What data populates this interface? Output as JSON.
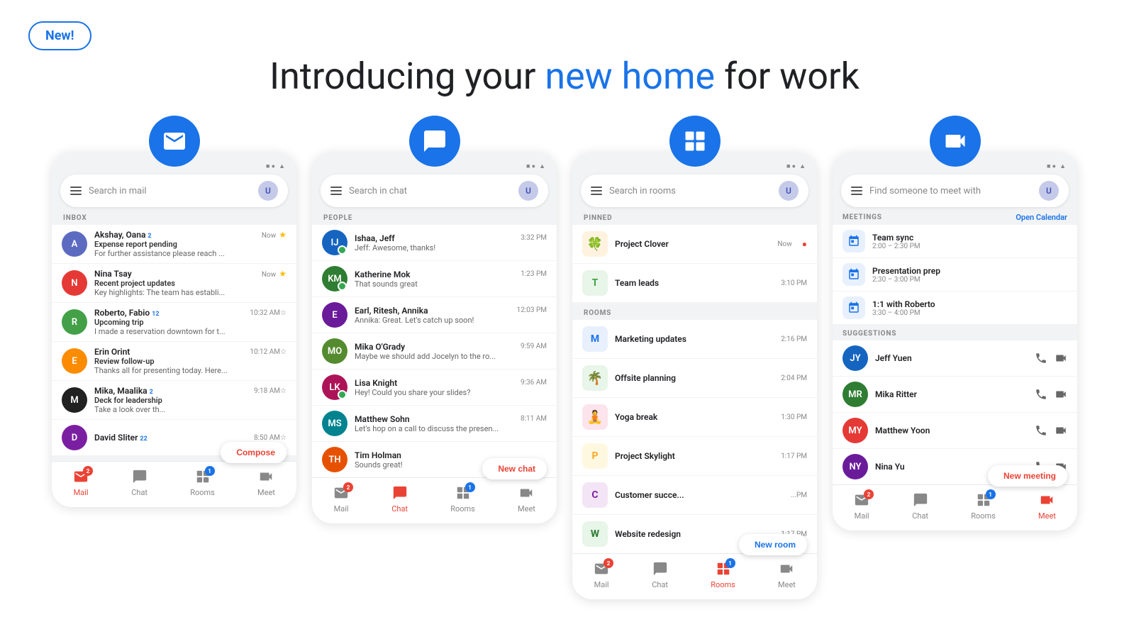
{
  "header": {
    "new_badge": "New!",
    "headline_part1": "Introducing your ",
    "headline_blue": "new home",
    "headline_part2": " for work"
  },
  "phones": [
    {
      "id": "mail",
      "app_icon": "mail",
      "search_placeholder": "Search in mail",
      "section_label": "INBOX",
      "items": [
        {
          "name": "Akshay, Oana",
          "badge": "2",
          "time": "Now",
          "subject": "Expense report pending",
          "preview": "For further assistance please reach ...",
          "starred": true,
          "avatar_color": "#5c6bc0",
          "avatar_text": "A"
        },
        {
          "name": "Nina Tsay",
          "badge": "",
          "time": "Now",
          "subject": "Recent project updates",
          "preview": "Key highlights: The team has establi...",
          "starred": true,
          "avatar_color": "#e53935",
          "avatar_text": "N"
        },
        {
          "name": "Roberto, Fabio",
          "badge": "12",
          "time": "10:32 AM",
          "subject": "Upcoming trip",
          "preview": "I made a reservation downtown for t...",
          "starred": false,
          "avatar_color": "#43a047",
          "avatar_text": "R"
        },
        {
          "name": "Erin Orint",
          "badge": "",
          "time": "10:12 AM",
          "subject": "Review follow-up",
          "preview": "Thanks all for presenting today. Here...",
          "starred": false,
          "avatar_color": "#fb8c00",
          "avatar_text": "E"
        },
        {
          "name": "Mika, Maalika",
          "badge": "2",
          "time": "9:18 AM",
          "subject": "Deck for leadership",
          "preview": "Take a look over th...",
          "starred": false,
          "avatar_color": "#212121",
          "avatar_text": "M"
        },
        {
          "name": "David Sliter",
          "badge": "22",
          "time": "8:50 AM",
          "subject": "",
          "preview": "",
          "starred": false,
          "avatar_color": "#7b1fa2",
          "avatar_text": "D"
        }
      ],
      "fab_label": "Compose",
      "fab_type": "compose",
      "nav": [
        {
          "label": "Mail",
          "active": true,
          "badge": "2",
          "icon": "mail"
        },
        {
          "label": "Chat",
          "active": false,
          "badge": "",
          "icon": "chat"
        },
        {
          "label": "Rooms",
          "active": false,
          "badge": "1",
          "icon": "rooms"
        },
        {
          "label": "Meet",
          "active": false,
          "badge": "",
          "icon": "meet"
        }
      ]
    },
    {
      "id": "chat",
      "app_icon": "chat",
      "search_placeholder": "Search in chat",
      "section_label": "PEOPLE",
      "items": [
        {
          "name": "Ishaa, Jeff",
          "time": "3:32 PM",
          "preview": "Jeff: Awesome, thanks!",
          "avatar_color": "#1565c0",
          "avatar_text": "IJ",
          "online": true
        },
        {
          "name": "Katherine Mok",
          "time": "1:23 PM",
          "preview": "That sounds great",
          "avatar_color": "#2e7d32",
          "avatar_text": "KM",
          "online": true
        },
        {
          "name": "Earl, Ritesh, Annika",
          "time": "12:03 PM",
          "preview": "Annika: Great. Let's catch up soon!",
          "avatar_color": "#6a1b9a",
          "avatar_text": "E",
          "online": false
        },
        {
          "name": "Mika O'Grady",
          "time": "9:59 AM",
          "preview": "Maybe we should add Jocelyn to the ro...",
          "avatar_color": "#558b2f",
          "avatar_text": "MO",
          "online": false
        },
        {
          "name": "Lisa Knight",
          "time": "9:36 AM",
          "preview": "Hey! Could you share your slides?",
          "avatar_color": "#ad1457",
          "avatar_text": "LK",
          "online": true
        },
        {
          "name": "Matthew Sohn",
          "time": "8:11 AM",
          "preview": "Let's hop on a call to discuss the presen...",
          "avatar_color": "#00838f",
          "avatar_text": "MS",
          "online": false
        },
        {
          "name": "Tim Holman",
          "time": "",
          "preview": "Sounds great!",
          "avatar_color": "#e65100",
          "avatar_text": "TH",
          "online": false
        }
      ],
      "fab_label": "New chat",
      "fab_type": "new-chat",
      "nav": [
        {
          "label": "Mail",
          "active": false,
          "badge": "2",
          "icon": "mail"
        },
        {
          "label": "Chat",
          "active": true,
          "badge": "",
          "icon": "chat"
        },
        {
          "label": "Rooms",
          "active": false,
          "badge": "1",
          "icon": "rooms"
        },
        {
          "label": "Meet",
          "active": false,
          "badge": "",
          "icon": "meet"
        }
      ]
    },
    {
      "id": "rooms",
      "app_icon": "rooms",
      "search_placeholder": "Search in rooms",
      "pinned_label": "PINNED",
      "pinned": [
        {
          "name": "Project Clover",
          "time": "Now",
          "now": true,
          "icon": "🍀",
          "icon_bg": "#fff3e0"
        },
        {
          "name": "Team leads",
          "time": "3:10 PM",
          "now": false,
          "icon": "T",
          "icon_bg": "#e8f5e9",
          "icon_color": "#43a047"
        }
      ],
      "rooms_label": "ROOMS",
      "rooms": [
        {
          "name": "Marketing updates",
          "time": "2:16 PM",
          "icon": "M",
          "icon_bg": "#e8f0fe",
          "icon_color": "#1a73e8"
        },
        {
          "name": "Offsite planning",
          "time": "2:04 PM",
          "icon": "🌴",
          "icon_bg": "#e8f5e9"
        },
        {
          "name": "Yoga break",
          "time": "1:30 PM",
          "icon": "🧘",
          "icon_bg": "#fce4ec"
        },
        {
          "name": "Project Skylight",
          "time": "1:17 PM",
          "icon": "P",
          "icon_bg": "#fff8e1",
          "icon_color": "#f9a825"
        },
        {
          "name": "Customer succe...",
          "time": "...PM",
          "icon": "C",
          "icon_bg": "#f3e5f5",
          "icon_color": "#7b1fa2"
        },
        {
          "name": "Website redesign",
          "time": "1:17 PM",
          "icon": "W",
          "icon_bg": "#e8f5e9",
          "icon_color": "#2e7d32"
        }
      ],
      "fab_label": "New room",
      "fab_type": "new-room",
      "nav": [
        {
          "label": "Mail",
          "active": false,
          "badge": "2",
          "icon": "mail"
        },
        {
          "label": "Chat",
          "active": false,
          "badge": "",
          "icon": "chat"
        },
        {
          "label": "Rooms",
          "active": true,
          "badge": "1",
          "icon": "rooms"
        },
        {
          "label": "Meet",
          "active": false,
          "badge": "",
          "icon": "meet"
        }
      ]
    },
    {
      "id": "meet",
      "app_icon": "meet",
      "search_placeholder": "Find someone to meet with",
      "meetings_label": "MEETINGS",
      "open_calendar": "Open Calendar",
      "meetings": [
        {
          "name": "Team sync",
          "time": "2:00 – 2:30 PM"
        },
        {
          "name": "Presentation prep",
          "time": "2:30 – 3:00 PM"
        },
        {
          "name": "1:1 with Roberto",
          "time": "3:30 – 4:00 PM"
        }
      ],
      "suggestions_label": "SUGGESTIONS",
      "suggestions": [
        {
          "name": "Jeff Yuen",
          "avatar_color": "#1565c0",
          "avatar_text": "JY"
        },
        {
          "name": "Mika Ritter",
          "avatar_color": "#2e7d32",
          "avatar_text": "MR"
        },
        {
          "name": "Matthew Yoon",
          "avatar_color": "#e53935",
          "avatar_text": "MY"
        },
        {
          "name": "Nina Yu",
          "avatar_color": "#6a1b9a",
          "avatar_text": "NY"
        }
      ],
      "fab_label": "New meeting",
      "fab_type": "new-meeting",
      "nav": [
        {
          "label": "Mail",
          "active": false,
          "badge": "2",
          "icon": "mail"
        },
        {
          "label": "Chat",
          "active": false,
          "badge": "",
          "icon": "chat"
        },
        {
          "label": "Rooms",
          "active": false,
          "badge": "1",
          "icon": "rooms"
        },
        {
          "label": "Meet",
          "active": true,
          "badge": "",
          "icon": "meet"
        }
      ]
    }
  ]
}
